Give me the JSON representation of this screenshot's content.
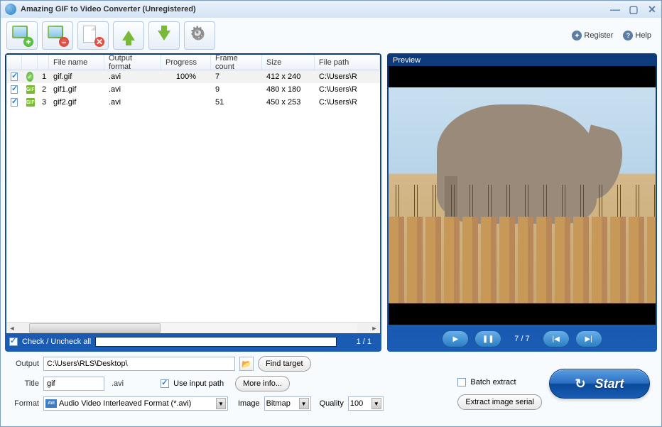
{
  "window": {
    "title": "Amazing GIF to Video Converter (Unregistered)"
  },
  "top_links": {
    "register": "Register",
    "help": "Help"
  },
  "table": {
    "headers": {
      "filename": "File name",
      "format": "Output format",
      "progress": "Progress",
      "frames": "Frame count",
      "size": "Size",
      "path": "File path"
    },
    "rows": [
      {
        "checked": true,
        "status": "done",
        "idx": "1",
        "name": "gif.gif",
        "fmt": ".avi",
        "prog": "100%",
        "frames": "7",
        "size": "412 x 240",
        "path": "C:\\Users\\R"
      },
      {
        "checked": true,
        "status": "gif",
        "idx": "2",
        "name": "gif1.gif",
        "fmt": ".avi",
        "prog": "",
        "frames": "9",
        "size": "480 x 180",
        "path": "C:\\Users\\R"
      },
      {
        "checked": true,
        "status": "gif",
        "idx": "3",
        "name": "gif2.gif",
        "fmt": ".avi",
        "prog": "",
        "frames": "51",
        "size": "450 x 253",
        "path": "C:\\Users\\R"
      }
    ]
  },
  "list_footer": {
    "check_all": "Check / Uncheck all",
    "page": "1 / 1"
  },
  "preview": {
    "label": "Preview",
    "frame_pos": "7 / 7"
  },
  "output": {
    "label": "Output",
    "path": "C:\\Users\\RLS\\Desktop\\",
    "find_target": "Find target"
  },
  "title_row": {
    "label": "Title",
    "value": "gif",
    "ext": ".avi",
    "use_input_path": "Use input path",
    "more_info": "More info..."
  },
  "format_row": {
    "label": "Format",
    "value": "Audio Video Interleaved Format (*.avi)",
    "image_label": "Image",
    "image_value": "Bitmap",
    "quality_label": "Quality",
    "quality_value": "100"
  },
  "batch": {
    "batch_extract": "Batch extract",
    "extract_serial": "Extract image serial"
  },
  "start": {
    "label": "Start"
  }
}
